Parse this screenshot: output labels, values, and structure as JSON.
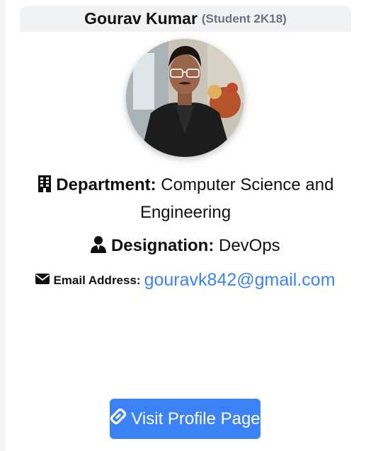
{
  "profile": {
    "name": "Gourav Kumar",
    "subtitle": "(Student 2K18)",
    "department_label": "Department:",
    "department_value": "Computer Science and Engineering",
    "designation_label": "Designation:",
    "designation_value": "DevOps",
    "email_label": "Email Address:",
    "email_value": "gouravk842@gmail.com"
  },
  "button": {
    "visit_label": "Visit Profile Page"
  },
  "icons": {
    "department": "building-icon",
    "designation": "user-tie-icon",
    "email": "envelope-icon",
    "visit": "link-icon"
  },
  "colors": {
    "accent": "#3b82f6",
    "header_bg": "#f1f2f4",
    "subtitle": "#6b7280"
  }
}
